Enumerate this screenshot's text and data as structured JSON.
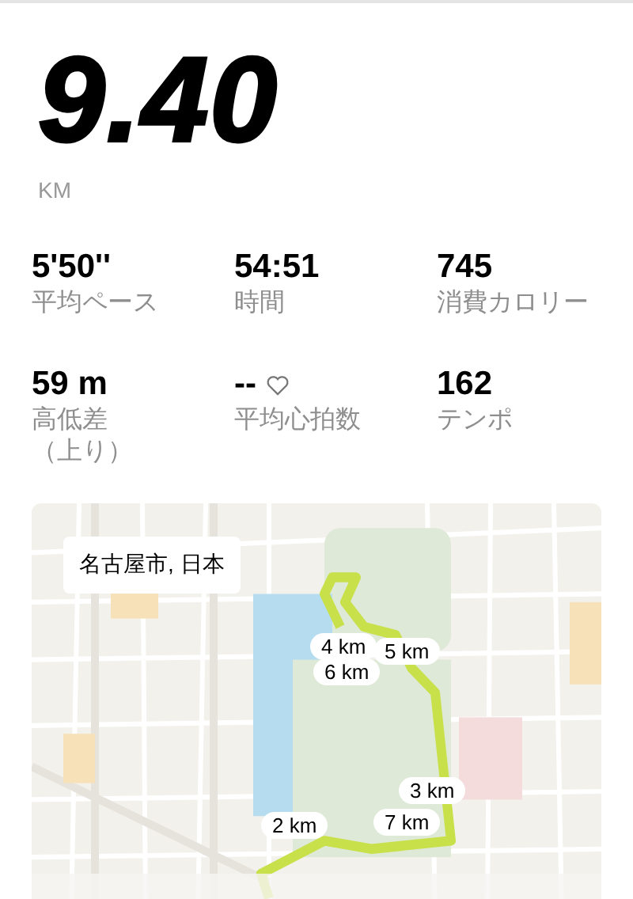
{
  "distance": {
    "value": "9.40",
    "unit": "KM"
  },
  "stats": [
    {
      "kind": "plain",
      "value": "5'50''",
      "label": "平均ペース"
    },
    {
      "kind": "plain",
      "value": "54:51",
      "label": "時間"
    },
    {
      "kind": "plain",
      "value": "745",
      "label": "消費カロリー"
    },
    {
      "kind": "plain",
      "value": "59 m",
      "label": "高低差（上り）"
    },
    {
      "kind": "heart",
      "value": "--",
      "label": "平均心拍数"
    },
    {
      "kind": "plain",
      "value": "162",
      "label": "テンポ"
    }
  ],
  "map": {
    "place_label": "名古屋市, 日本",
    "markers": [
      "4 km",
      "5 km",
      "6 km",
      "3 km",
      "7 km",
      "2 km"
    ]
  }
}
